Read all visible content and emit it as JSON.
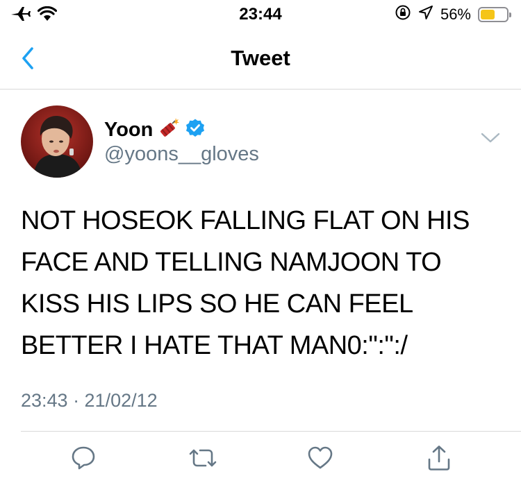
{
  "status_bar": {
    "time": "23:44",
    "battery_percent_text": "56%",
    "battery_level": 0.56,
    "battery_color": "#f5c518"
  },
  "nav": {
    "title": "Tweet",
    "back_icon": "chevron-left-icon",
    "accent_color": "#1da1f2"
  },
  "tweet": {
    "author_name": "Yoon",
    "author_emoji": "firecracker-emoji",
    "verified_icon": "verified-badge-icon",
    "handle": "@yoons__gloves",
    "text": "NOT HOSEOK FALLING FLAT ON HIS\nFACE AND TELLING NAMJOON TO\nKISS HIS LIPS SO HE CAN FEEL\nBETTER I HATE THAT MAN0:\":\":/",
    "timestamp": "23:43 · 21/02/12"
  },
  "actions": [
    {
      "icon": "reply-icon"
    },
    {
      "icon": "retweet-icon"
    },
    {
      "icon": "like-icon"
    },
    {
      "icon": "share-icon"
    }
  ]
}
